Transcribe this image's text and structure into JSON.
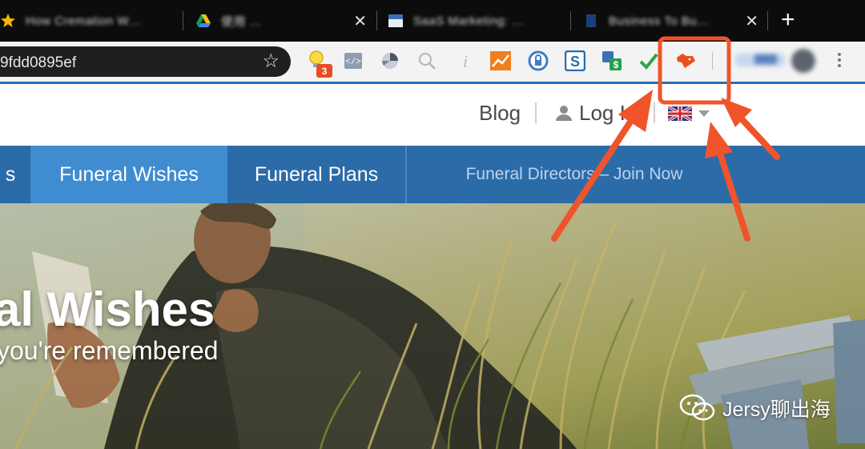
{
  "browser": {
    "tabs": [
      {
        "title": "How Cremation W…"
      },
      {
        "title": "使用 …"
      },
      {
        "title": "SaaS Marketing: …"
      },
      {
        "title": "Business To Bu…"
      }
    ],
    "new_tab_label": "+",
    "close_glyph": "✕",
    "address_bar": {
      "url": "9fdd0895ef",
      "bookmark_icon": "star-icon"
    },
    "extensions": [
      {
        "name": "lightbulb-extension-icon",
        "badge": "3"
      },
      {
        "name": "code-view-extension-icon"
      },
      {
        "name": "pie-chart-extension-icon"
      },
      {
        "name": "magnifier-extension-icon"
      },
      {
        "name": "info-extension-icon"
      },
      {
        "name": "trend-chart-extension-icon"
      },
      {
        "name": "lock-gauge-extension-icon"
      },
      {
        "name": "s-square-extension-icon"
      },
      {
        "name": "s-dollar-extension-icon"
      },
      {
        "name": "checkmark-extension-icon"
      },
      {
        "name": "fox-head-extension-icon"
      }
    ],
    "colors": {
      "tab_strip": "#0c0c0c",
      "toolbar": "#f3f3f3",
      "highlight": "#f0542a"
    }
  },
  "site": {
    "top_nav": {
      "blog": "Blog",
      "login": "Log In",
      "separator": "|",
      "language_flag": "uk-flag-icon"
    },
    "main_nav": {
      "items": [
        {
          "label": "s"
        },
        {
          "label": "Funeral Wishes"
        },
        {
          "label": "Funeral Plans"
        },
        {
          "label": "Funeral Directors – Join Now"
        }
      ],
      "colors": {
        "bar": "#2b6ba8",
        "active": "#3f8cd0"
      }
    },
    "hero": {
      "title": "al Wishes",
      "subtitle": "you're remembered"
    }
  },
  "watermark": {
    "label": "Jersy聊出海",
    "icon": "wechat-icon"
  }
}
